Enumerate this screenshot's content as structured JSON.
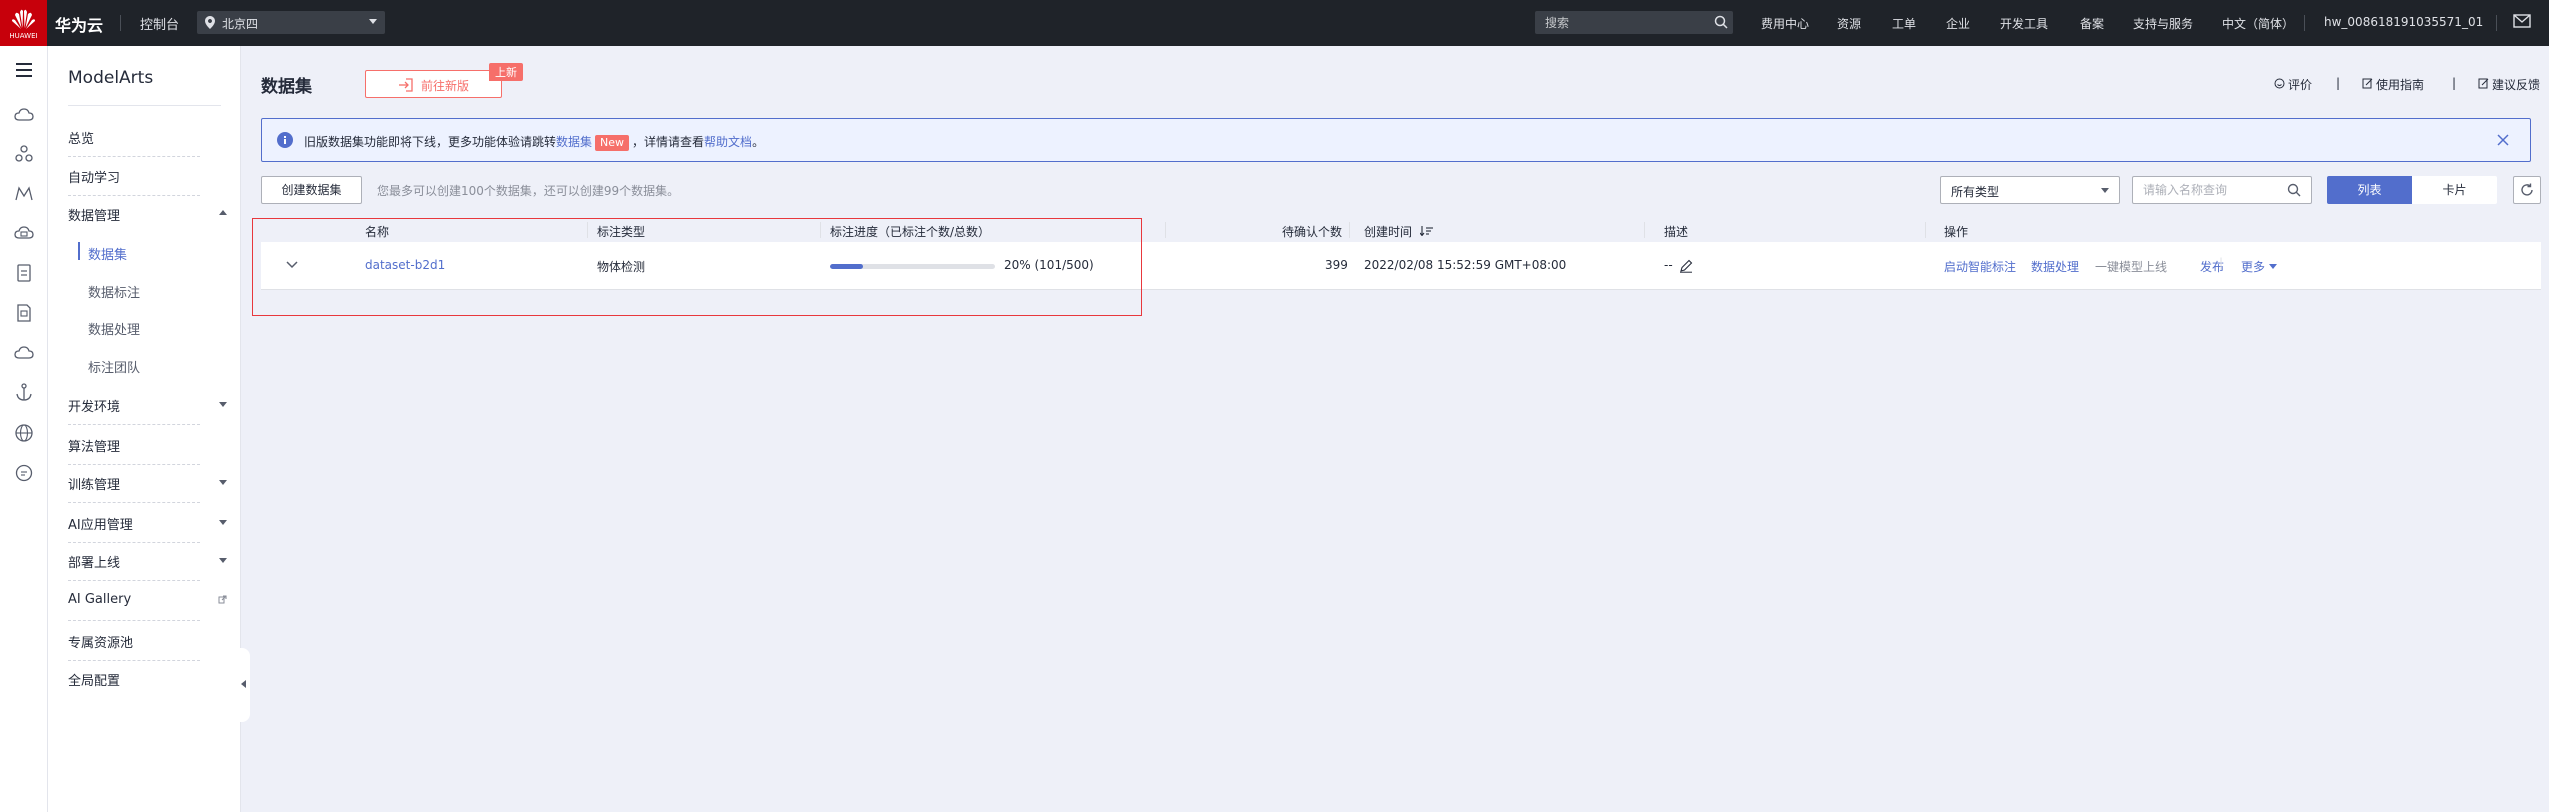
{
  "topbar": {
    "logo_text": "HUAWEI",
    "brand": "华为云",
    "console": "控制台",
    "region": "北京四",
    "search_placeholder": "搜索",
    "nav": [
      "费用中心",
      "资源",
      "工单",
      "企业",
      "开发工具",
      "备案",
      "支持与服务",
      "中文（简体）"
    ],
    "username": "hw_008618191035571_01"
  },
  "sidebar": {
    "title": "ModelArts",
    "items": [
      {
        "label": "总览"
      },
      {
        "label": "自动学习"
      },
      {
        "label": "数据管理",
        "expanded": true,
        "children": [
          "数据集",
          "数据标注",
          "数据处理",
          "标注团队"
        ],
        "active_child": "数据集"
      },
      {
        "label": "开发环境",
        "caret": "down"
      },
      {
        "label": "算法管理"
      },
      {
        "label": "训练管理",
        "caret": "down"
      },
      {
        "label": "AI应用管理",
        "caret": "down"
      },
      {
        "label": "部署上线",
        "caret": "down"
      },
      {
        "label": "AI Gallery",
        "external": true
      },
      {
        "label": "专属资源池"
      },
      {
        "label": "全局配置"
      }
    ]
  },
  "rail_icons": [
    "menu-icon",
    "cloud-icon",
    "nodes-icon",
    "route-icon",
    "cube-cloud-icon",
    "clipboard-icon",
    "document-icon",
    "cloud-outline-icon",
    "anchor-icon",
    "globe-icon",
    "chat-icon"
  ],
  "main": {
    "page_title": "数据集",
    "new_version_btn": "前往新版",
    "new_badge": "上新",
    "top_links": [
      "评价",
      "使用指南",
      "建议反馈"
    ],
    "notice": {
      "part1": "旧版数据集功能即将下线，更多功能体验请跳转",
      "link1": "数据集",
      "badge": "New",
      "part2": "，详情请查看",
      "link2": "帮助文档",
      "part3": "。"
    },
    "create_btn": "创建数据集",
    "quota_text": "您最多可以创建100个数据集，还可以创建99个数据集。",
    "type_select": "所有类型",
    "name_search_placeholder": "请输入名称查询",
    "view_list": "列表",
    "view_card": "卡片"
  },
  "table": {
    "columns": [
      "名称",
      "标注类型",
      "标注进度（已标注个数/总数）",
      "待确认个数",
      "创建时间",
      "描述",
      "操作"
    ],
    "rows": [
      {
        "name": "dataset-b2d1",
        "label_type": "物体检测",
        "progress_percent": 20,
        "progress_text": "20% (101/500)",
        "pending": "399",
        "created": "2022/02/08 15:52:59 GMT+08:00",
        "description": "--",
        "actions": [
          "启动智能标注",
          "数据处理",
          "一键模型上线",
          "发布",
          "更多"
        ]
      }
    ]
  },
  "colors": {
    "brand_red": "#c7000b",
    "accent": "#526ecc",
    "badge": "#f66f6a",
    "highlight": "#e8383d"
  }
}
